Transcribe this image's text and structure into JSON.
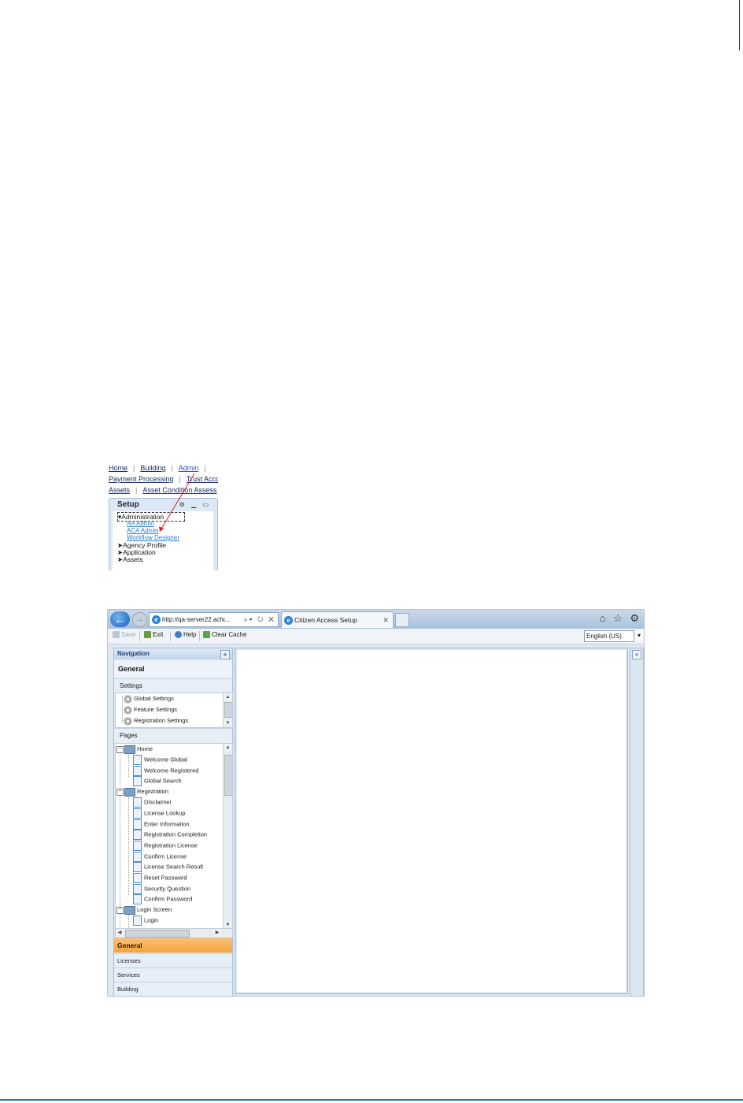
{
  "admin_menu": {
    "row1": [
      "Home",
      "Building",
      "Admin"
    ],
    "row2": [
      "Payment Processing",
      "Trust Acco"
    ],
    "row3": [
      "Assets",
      "Asset Condition Assess"
    ],
    "setup_title": "Setup",
    "tree_root": "Administration",
    "tree_children": [
      "AA Admin",
      "ACA Admin",
      "Workflow Designer"
    ],
    "tree_siblings": [
      "Agency Profile",
      "Application",
      "Assets"
    ]
  },
  "browser": {
    "address": "http://qa-server22.achi...",
    "tab_title": "Citizen Access Setup",
    "toolbar": {
      "save": "Save",
      "exit": "Exit",
      "help": "Help",
      "clear_cache": "Clear Cache",
      "language": "English (US)"
    },
    "nav": {
      "header": "Navigation",
      "module": "General",
      "settings_label": "Settings",
      "settings_items": [
        "Global Settings",
        "Feature Settings",
        "Registration Settings"
      ],
      "pages_label": "Pages",
      "home_folder": "Home",
      "home_pages": [
        "Welcome Global",
        "Welcome Registered",
        "Global Search"
      ],
      "registration_folder": "Registration",
      "registration_pages": [
        "Disclaimer",
        "License Lookup",
        "Enter Information",
        "Registration Completion",
        "Registration License",
        "Confirm License",
        "License Search Result",
        "Reset Password",
        "Security Question",
        "Confirm Password"
      ],
      "login_folder": "Login Screen",
      "login_pages": [
        "Login"
      ],
      "bottom_selected": "General",
      "bottom_items": [
        "Licenses",
        "Services",
        "Building"
      ]
    }
  },
  "colors": {
    "selected_module": "#f4a43c",
    "panel_bg": "#dbe6f2",
    "link_blue": "#2a7dcf"
  }
}
